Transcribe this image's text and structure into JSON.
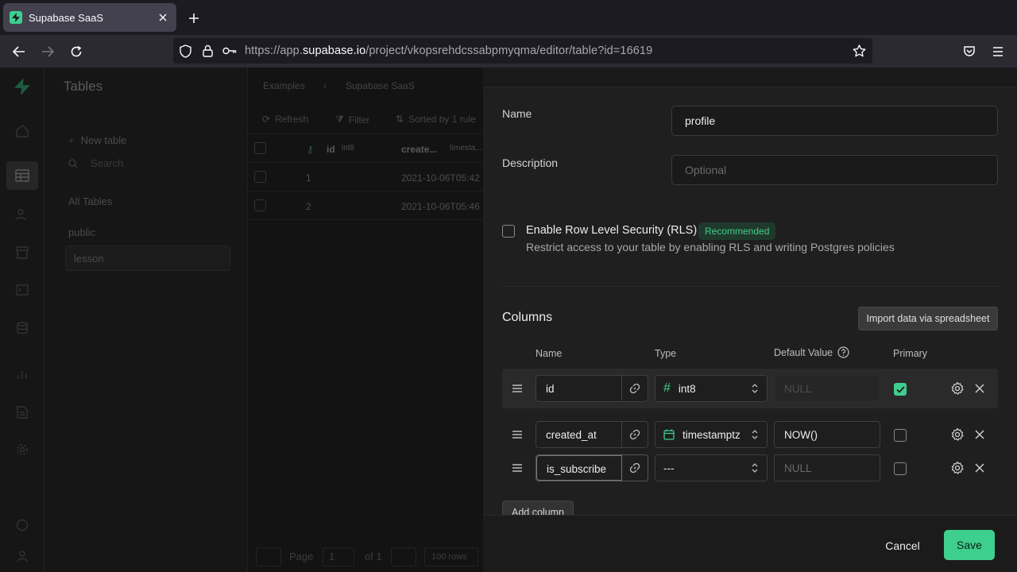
{
  "browser": {
    "tab_title": "Supabase SaaS",
    "url_prefix": "https://app.",
    "url_host": "supabase.io",
    "url_path": "/project/vkopsrehdcssabpmyqma/editor/table?id=16619"
  },
  "sidebar": {
    "title": "Tables",
    "new_table": "New table",
    "search_placeholder": "Search",
    "all_tables": "All Tables",
    "schema_label": "public",
    "selected_table": "lesson"
  },
  "main": {
    "breadcrumb": [
      "Examples",
      "Supabase SaaS"
    ],
    "toolbar": {
      "refresh": "Refresh",
      "filter": "Filter",
      "sorted": "Sorted by 1 rule"
    },
    "grid_headers": {
      "id": "id",
      "id_type": "int8",
      "created": "create...",
      "created_type": "timesta..."
    },
    "rows": [
      {
        "id": "1",
        "created": "2021-10-06T05:42"
      },
      {
        "id": "2",
        "created": "2021-10-06T05:46"
      }
    ],
    "footer": {
      "page_label": "Page",
      "page_value": "1",
      "of": "of 1",
      "rows": "100 rows"
    }
  },
  "panel": {
    "name_label": "Name",
    "name_value": "profile",
    "description_label": "Description",
    "description_placeholder": "Optional",
    "rls_title": "Enable Row Level Security (RLS)",
    "rls_badge": "Recommended",
    "rls_desc": "Restrict access to your table by enabling RLS and writing Postgres policies",
    "columns_title": "Columns",
    "import_button": "Import data via spreadsheet",
    "headers": {
      "name": "Name",
      "type": "Type",
      "default": "Default Value",
      "primary": "Primary"
    },
    "columns": [
      {
        "name": "id",
        "type": "int8",
        "default": "NULL",
        "primary": true
      },
      {
        "name": "created_at",
        "type": "timestamptz",
        "default": "NOW()",
        "primary": false
      },
      {
        "name": "is_subscribe",
        "type": "---",
        "default": "NULL",
        "primary": false
      }
    ],
    "add_column": "Add column",
    "cancel": "Cancel",
    "save": "Save"
  },
  "colors": {
    "accent": "#3ecf8e",
    "panel_bg": "#1f1f1f",
    "overlay_bg": "#161616"
  }
}
